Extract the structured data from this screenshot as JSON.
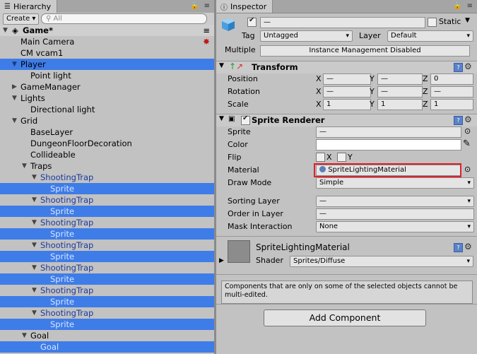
{
  "hierarchy": {
    "tab_label": "Hierarchy",
    "create_label": "Create",
    "search_placeholder": "All",
    "scene_name": "Game*",
    "rows": [
      {
        "label": "Main Camera",
        "depth": 1,
        "arrow": "",
        "blue": false,
        "selected": false
      },
      {
        "label": "CM vcam1",
        "depth": 1,
        "arrow": "",
        "blue": false,
        "selected": false
      },
      {
        "label": "Player",
        "depth": 1,
        "arrow": "down",
        "blue": false,
        "selected": true
      },
      {
        "label": "Point light",
        "depth": 2,
        "arrow": "",
        "blue": false,
        "selected": false
      },
      {
        "label": "GameManager",
        "depth": 1,
        "arrow": "right",
        "blue": false,
        "selected": false
      },
      {
        "label": "Lights",
        "depth": 1,
        "arrow": "down",
        "blue": false,
        "selected": false
      },
      {
        "label": "Directional light",
        "depth": 2,
        "arrow": "",
        "blue": false,
        "selected": false
      },
      {
        "label": "Grid",
        "depth": 1,
        "arrow": "down",
        "blue": false,
        "selected": false
      },
      {
        "label": "BaseLayer",
        "depth": 2,
        "arrow": "",
        "blue": false,
        "selected": false
      },
      {
        "label": "DungeonFloorDecoration",
        "depth": 2,
        "arrow": "",
        "blue": false,
        "selected": false
      },
      {
        "label": "Collideable",
        "depth": 2,
        "arrow": "",
        "blue": false,
        "selected": false
      },
      {
        "label": "Traps",
        "depth": 2,
        "arrow": "down",
        "blue": false,
        "selected": false
      },
      {
        "label": "ShootingTrap",
        "depth": 3,
        "arrow": "down",
        "blue": true,
        "selected": false
      },
      {
        "label": "Sprite",
        "depth": 4,
        "arrow": "",
        "blue": true,
        "selected": true
      },
      {
        "label": "ShootingTrap",
        "depth": 3,
        "arrow": "down",
        "blue": true,
        "selected": false
      },
      {
        "label": "Sprite",
        "depth": 4,
        "arrow": "",
        "blue": true,
        "selected": true
      },
      {
        "label": "ShootingTrap",
        "depth": 3,
        "arrow": "down",
        "blue": true,
        "selected": false
      },
      {
        "label": "Sprite",
        "depth": 4,
        "arrow": "",
        "blue": true,
        "selected": true
      },
      {
        "label": "ShootingTrap",
        "depth": 3,
        "arrow": "down",
        "blue": true,
        "selected": false
      },
      {
        "label": "Sprite",
        "depth": 4,
        "arrow": "",
        "blue": true,
        "selected": true
      },
      {
        "label": "ShootingTrap",
        "depth": 3,
        "arrow": "down",
        "blue": true,
        "selected": false
      },
      {
        "label": "Sprite",
        "depth": 4,
        "arrow": "",
        "blue": true,
        "selected": true
      },
      {
        "label": "ShootingTrap",
        "depth": 3,
        "arrow": "down",
        "blue": true,
        "selected": false
      },
      {
        "label": "Sprite",
        "depth": 4,
        "arrow": "",
        "blue": true,
        "selected": true
      },
      {
        "label": "ShootingTrap",
        "depth": 3,
        "arrow": "down",
        "blue": true,
        "selected": false
      },
      {
        "label": "Sprite",
        "depth": 4,
        "arrow": "",
        "blue": true,
        "selected": true
      },
      {
        "label": "Goal",
        "depth": 2,
        "arrow": "down",
        "blue": false,
        "selected": false
      },
      {
        "label": "Goal",
        "depth": 3,
        "arrow": "",
        "blue": true,
        "selected": true
      }
    ]
  },
  "inspector": {
    "tab_label": "Inspector",
    "object_name": "—",
    "static_label": "Static",
    "tag_label": "Tag",
    "tag_value": "Untagged",
    "layer_label": "Layer",
    "layer_value": "Default",
    "multiple_label": "Multiple",
    "multiple_value": "Instance Management Disabled",
    "transform": {
      "title": "Transform",
      "position_label": "Position",
      "rotation_label": "Rotation",
      "scale_label": "Scale",
      "x": "X",
      "y": "Y",
      "z": "Z",
      "pos_x": "—",
      "pos_y": "—",
      "pos_z": "0",
      "rot_x": "—",
      "rot_y": "—",
      "rot_z": "—",
      "scale_x": "1",
      "scale_y": "1",
      "scale_z": "1"
    },
    "sprite_renderer": {
      "title": "Sprite Renderer",
      "sprite_label": "Sprite",
      "sprite_value": "—",
      "color_label": "Color",
      "flip_label": "Flip",
      "flip_x": "X",
      "flip_y": "Y",
      "material_label": "Material",
      "material_value": "SpriteLightingMaterial",
      "draw_mode_label": "Draw Mode",
      "draw_mode_value": "Simple",
      "sorting_layer_label": "Sorting Layer",
      "sorting_layer_value": "—",
      "order_label": "Order in Layer",
      "order_value": "—",
      "mask_label": "Mask Interaction",
      "mask_value": "None"
    },
    "material": {
      "name": "SpriteLightingMaterial",
      "shader_label": "Shader",
      "shader_value": "Sprites/Diffuse"
    },
    "notice": "Components that are only on some of the selected objects cannot be multi-edited.",
    "add_component": "Add Component"
  },
  "colors": {
    "selection": "#3e7ce8",
    "highlight": "#e0202a",
    "prefab_text": "#1b3a9e"
  }
}
